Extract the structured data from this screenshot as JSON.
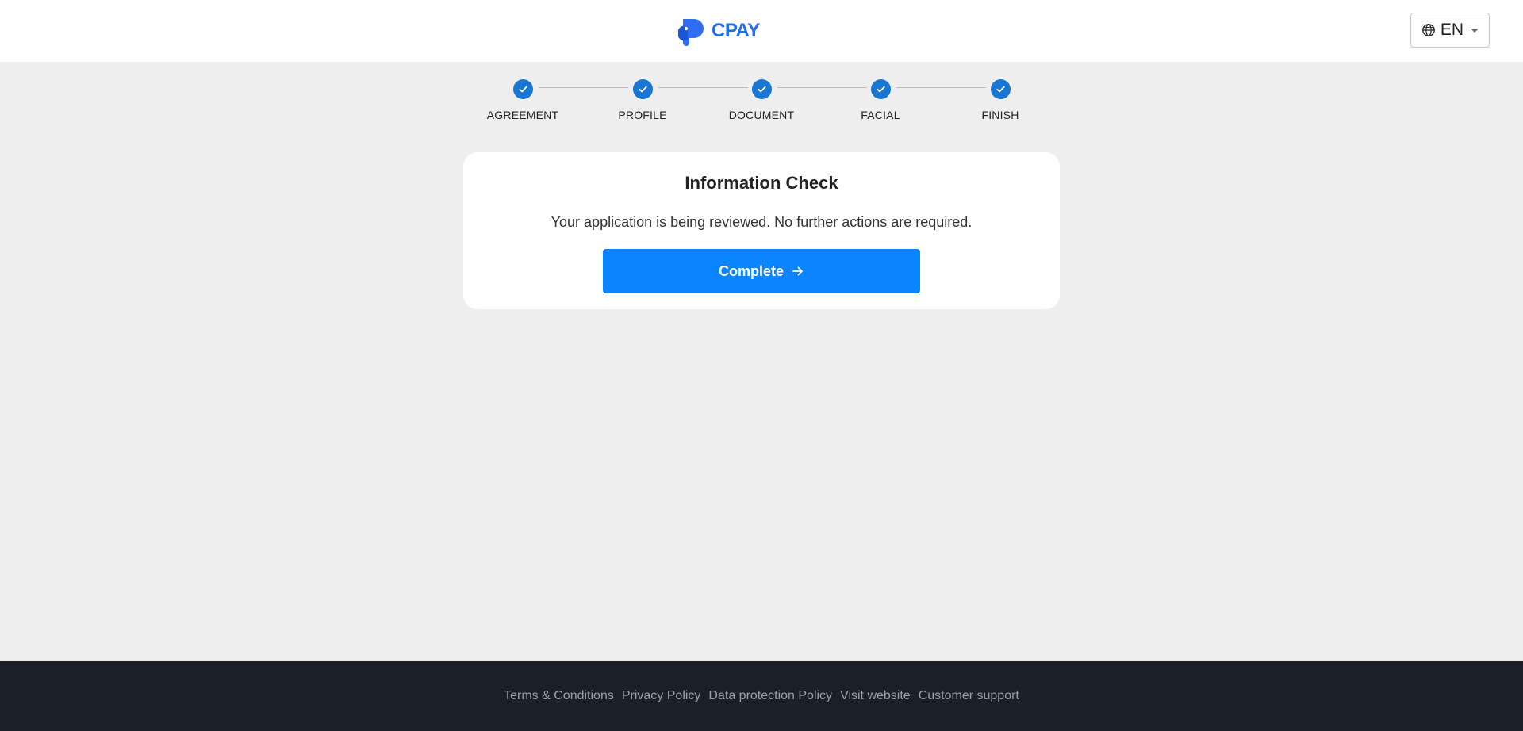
{
  "header": {
    "logo_text": "CPAY",
    "language": {
      "selected": "EN",
      "icon": "globe-icon"
    },
    "brand_color": "#1e6bf5"
  },
  "stepper": {
    "steps": [
      {
        "label": "AGREEMENT",
        "completed": true
      },
      {
        "label": "PROFILE",
        "completed": true
      },
      {
        "label": "DOCUMENT",
        "completed": true
      },
      {
        "label": "FACIAL",
        "completed": true
      },
      {
        "label": "FINISH",
        "completed": true
      }
    ],
    "active_color": "#1976d2"
  },
  "card": {
    "title": "Information Check",
    "message": "Your application is being reviewed. No further actions are required.",
    "button_label": "Complete",
    "button_icon": "arrow-right-icon",
    "button_color": "#0a84ff"
  },
  "footer": {
    "links": [
      "Terms & Conditions",
      "Privacy Policy",
      "Data protection Policy",
      "Visit website",
      "Customer support"
    ]
  }
}
